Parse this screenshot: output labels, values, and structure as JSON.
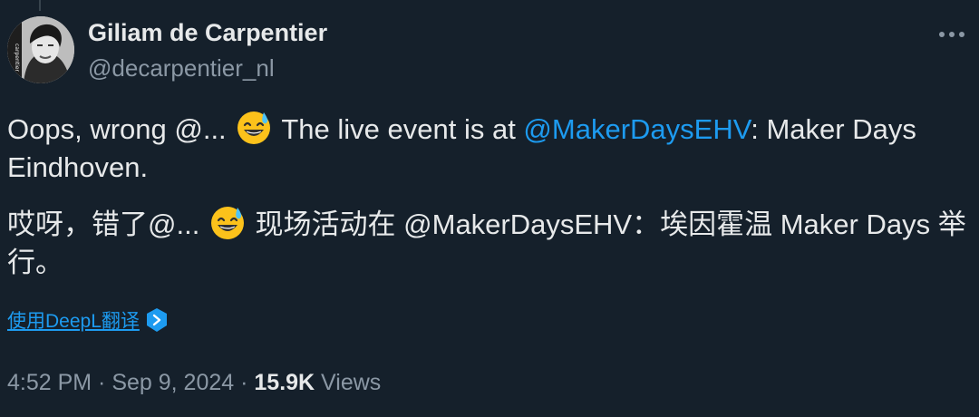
{
  "author": {
    "display_name": "Giliam de Carpentier",
    "handle": "@decarpentier_nl",
    "avatar_icon": "avatar-photo",
    "avatar_side_text": "carpentier"
  },
  "tweet": {
    "p1": {
      "a": "Oops, wrong @... ",
      "b": " The live event is at ",
      "mention": "@MakerDaysEHV",
      "c": ": Maker Days Eindhoven."
    },
    "p2": {
      "a": "哎呀，错了@... ",
      "b": " 现场活动在 @MakerDaysEHV：埃因霍温 Maker Days 举行。"
    },
    "emoji_icon": "sweat-smile-emoji"
  },
  "translate": {
    "label": "使用DeepL翻译",
    "icon": "deepl-icon"
  },
  "meta": {
    "time": "4:52 PM",
    "sep1": " · ",
    "date": "Sep 9, 2024",
    "sep2": " · ",
    "views_count": "15.9K",
    "views_label": " Views"
  },
  "colors": {
    "background": "#15202b",
    "text": "#e7e9ea",
    "muted": "#8b98a5",
    "link": "#1d9bf0"
  }
}
